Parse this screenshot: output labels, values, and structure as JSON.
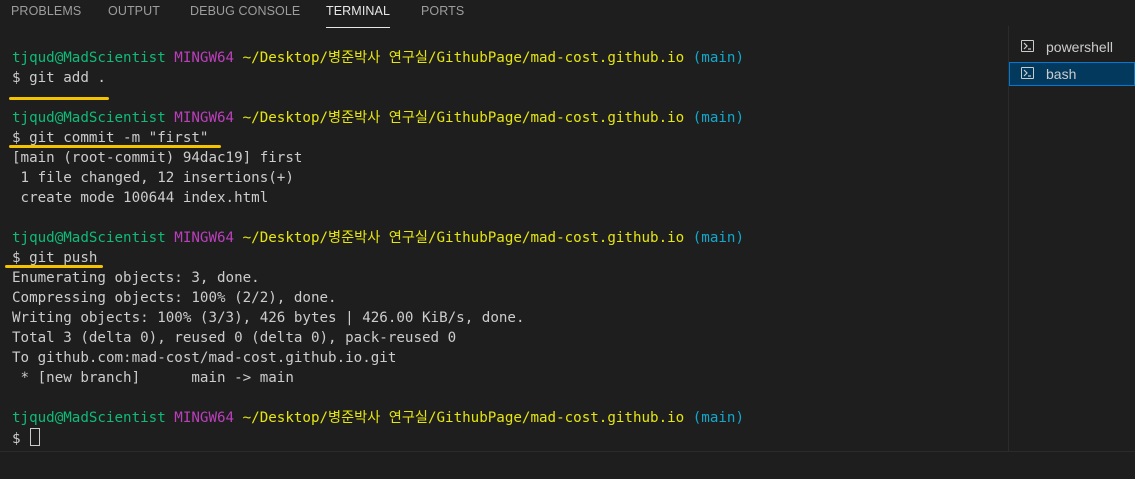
{
  "tabs": [
    {
      "label": "PROBLEMS"
    },
    {
      "label": "OUTPUT"
    },
    {
      "label": "DEBUG CONSOLE"
    },
    {
      "label": "TERMINAL"
    },
    {
      "label": "PORTS"
    }
  ],
  "active_tab": "TERMINAL",
  "terminal_list": [
    {
      "label": "powershell",
      "icon": "terminal-icon"
    },
    {
      "label": "bash",
      "icon": "terminal-icon"
    }
  ],
  "selected_terminal": "bash",
  "prompt": {
    "user_host": "tjqud@MadScientist",
    "shell": "MINGW64",
    "path": "~/Desktop/병준박사 연구실/GithubPage/mad-cost.github.io",
    "branch": "(main)"
  },
  "commands": {
    "cmd1": "$ git add .",
    "cmd2": "$ git commit -m \"first\"",
    "cmd3": "$ git push",
    "cmd4": "$ "
  },
  "output": {
    "commit": [
      "[main (root-commit) 94dac19] first",
      " 1 file changed, 12 insertions(+)",
      " create mode 100644 index.html"
    ],
    "push": [
      "Enumerating objects: 3, done.",
      "Compressing objects: 100% (2/2), done.",
      "Writing objects: 100% (3/3), 426 bytes | 426.00 KiB/s, done.",
      "Total 3 (delta 0), reused 0 (delta 0), pack-reused 0",
      "To github.com:mad-cost/mad-cost.github.io.git",
      " * [new branch]      main -> main"
    ]
  },
  "colors": {
    "user_host": "#0dbc79",
    "shell": "#bc3fbc",
    "path": "#e5e510",
    "branch": "#11a8cd",
    "highlight_underline": "#f5c400",
    "selected_bg": "#04395e"
  }
}
